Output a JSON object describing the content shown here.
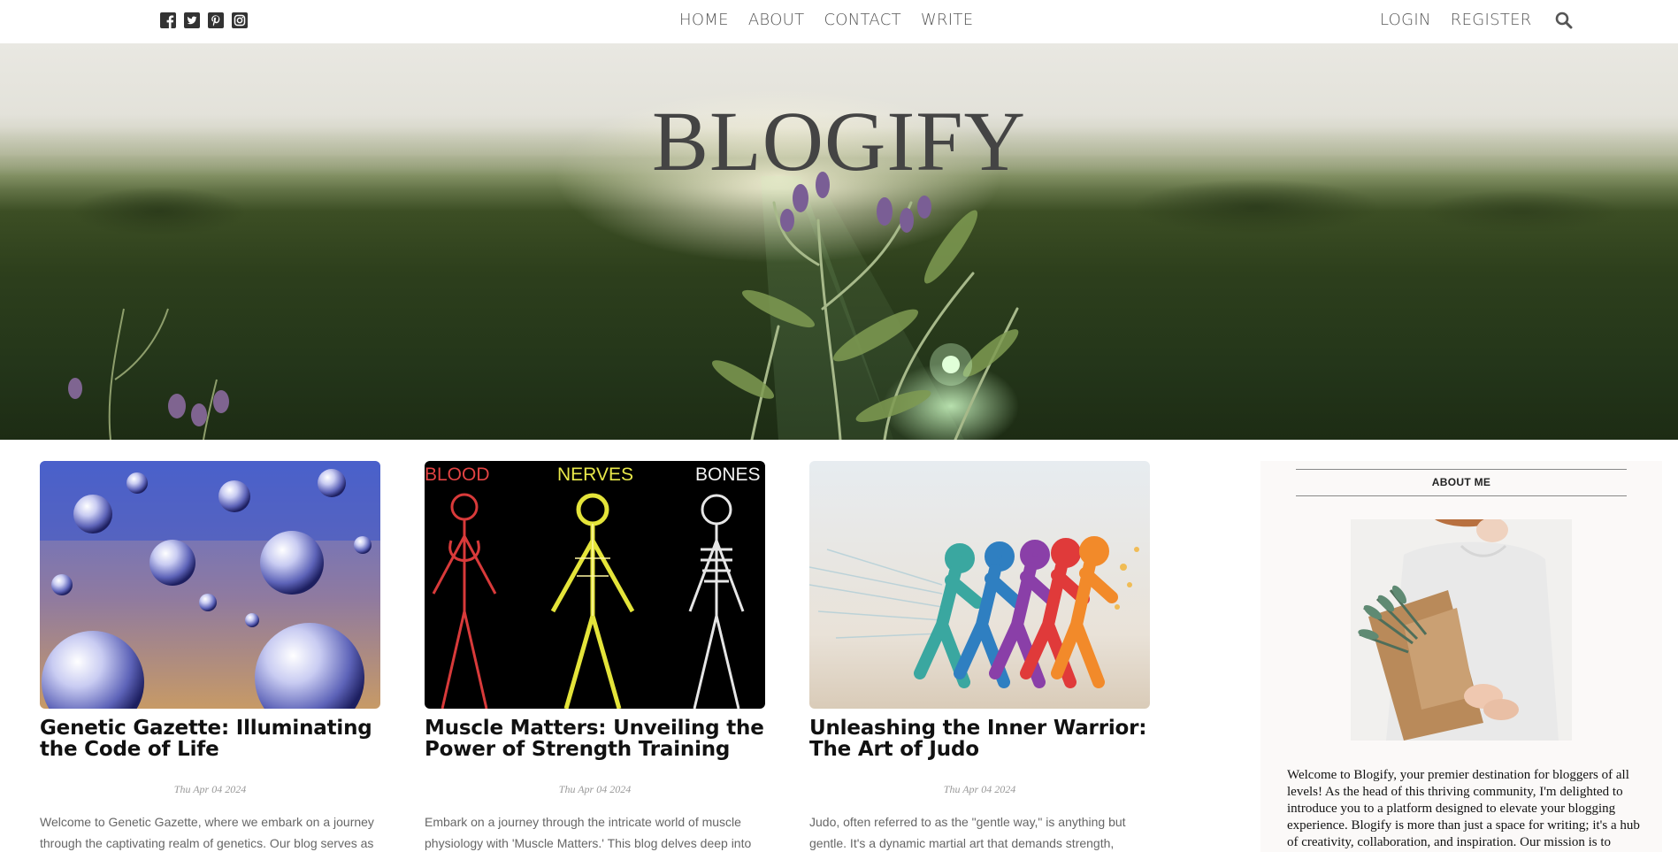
{
  "nav": {
    "socials": [
      {
        "icon": "facebook-icon"
      },
      {
        "icon": "twitter-icon"
      },
      {
        "icon": "pinterest-icon"
      },
      {
        "icon": "instagram-icon"
      }
    ],
    "center_links": [
      "HOME",
      "ABOUT",
      "CONTACT",
      "WRITE"
    ],
    "right_links": [
      "LOGIN",
      "REGISTER"
    ],
    "search_icon": "search-icon"
  },
  "hero": {
    "brand": "BLOGIFY"
  },
  "posts": [
    {
      "title": "Genetic Gazette: Illuminating the Code of Life",
      "date": "Thu Apr 04 2024",
      "excerpt": "Welcome to Genetic Gazette, where we embark on a journey through the captivating realm of genetics. Our blog serves as a beacon for those eager to unravel the mysteries encoded"
    },
    {
      "title": "Muscle Matters: Unveiling the Power of Strength Training",
      "date": "Thu Apr 04 2024",
      "excerpt": "Embark on a journey through the intricate world of muscle physiology with 'Muscle Matters.' This blog delves deep into the science behind strength training, exploring how muscles",
      "image_labels": [
        "BLOOD",
        "NERVES",
        "BONES"
      ]
    },
    {
      "title": "Unleashing the Inner Warrior: The Art of Judo",
      "date": "Thu Apr 04 2024",
      "excerpt": "Judo, often referred to as the \"gentle way,\" is anything but gentle. It's a dynamic martial art that demands strength, agility, and precision. Originating from Japan, judo focuses on"
    }
  ],
  "sidebar": {
    "heading": "ABOUT ME",
    "text": "Welcome to Blogify, your premier destination for bloggers of all levels! As the head of this thriving community, I'm delighted to introduce you to a platform designed to elevate your blogging experience. Blogify is more than just a space for writing; it's a hub of creativity, collaboration, and inspiration. Our mission is to provide you with the tools"
  },
  "colors": {
    "text_dark": "#444444",
    "title": "#111111",
    "muted": "#666666",
    "sidebar_bg": "#fbf9f8"
  }
}
